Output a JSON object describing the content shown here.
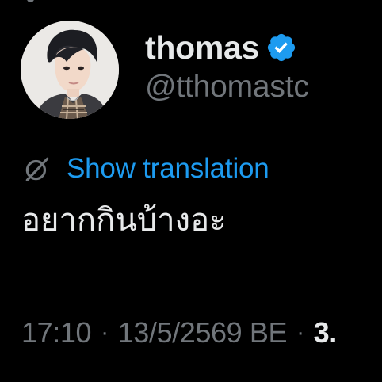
{
  "author": {
    "display_name": "thomas",
    "handle": "@tthomastc",
    "verified": true,
    "avatar_alt": "profile photo"
  },
  "translation": {
    "link_label": "Show translation"
  },
  "tweet": {
    "text": "อยากกินบ้างอะ"
  },
  "meta": {
    "time": "17:10",
    "separator": "·",
    "date": "13/5/2569 BE",
    "views": "3."
  },
  "colors": {
    "background": "#000000",
    "primary_text": "#e7e9ea",
    "secondary_text": "#71767b",
    "link": "#1d9bf0",
    "verified_badge": "#1d9bf0"
  }
}
